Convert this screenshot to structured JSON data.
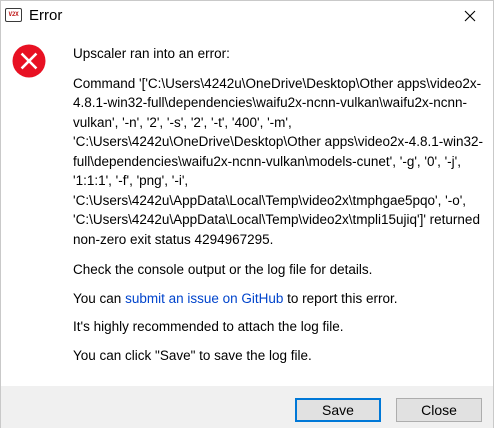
{
  "window": {
    "title": "Error",
    "app_icon_text": "V2X"
  },
  "message": {
    "heading": "Upscaler ran into an error:",
    "command": "Command '['C:\\Users\\4242u\\OneDrive\\Desktop\\Other apps\\video2x-4.8.1-win32-full\\dependencies\\waifu2x-ncnn-vulkan\\waifu2x-ncnn-vulkan', '-n', '2', '-s', '2', '-t', '400', '-m', 'C:\\Users\\4242u\\OneDrive\\Desktop\\Other apps\\video2x-4.8.1-win32-full\\dependencies\\waifu2x-ncnn-vulkan\\models-cunet', '-g', '0', '-j', '1:1:1', '-f', 'png', '-i', 'C:\\Users\\4242u\\AppData\\Local\\Temp\\video2x\\tmphgae5pqo', '-o', 'C:\\Users\\4242u\\AppData\\Local\\Temp\\video2x\\tmpli15ujiq']' returned non-zero exit status 4294967295.",
    "check_console": "Check the console output or the log file for details.",
    "issue_prefix": "You can ",
    "issue_link": "submit an issue on GitHub",
    "issue_suffix": " to report this error.",
    "recommend": "It's highly recommended to attach the log file.",
    "save_hint": "You can click \"Save\" to save the log file."
  },
  "buttons": {
    "save": "Save",
    "close": "Close"
  },
  "icons": {
    "app": "app-logo-icon",
    "close": "close-icon",
    "error": "error-icon"
  },
  "colors": {
    "error_red": "#e81123",
    "link_blue": "#0044cc",
    "default_button_border": "#0078d7",
    "footer_bg": "#f0f0f0"
  }
}
